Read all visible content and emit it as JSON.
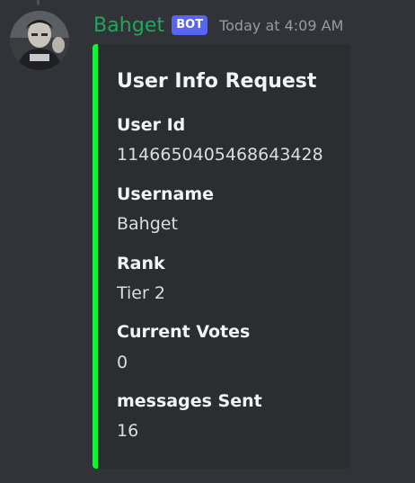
{
  "message": {
    "author": "Bahget",
    "bot_tag": "BOT",
    "timestamp": "Today at 4:09 AM",
    "avatar_icon": "user-avatar",
    "colors": {
      "author": "#23a55a",
      "bot_tag_bg": "#5865f2",
      "embed_accent": "#00ff2a",
      "background": "#313338",
      "embed_bg": "#2b2d31"
    }
  },
  "embed": {
    "title": "User Info Request",
    "fields": [
      {
        "name": "User Id",
        "value": "1146650405468643428"
      },
      {
        "name": "Username",
        "value": "Bahget"
      },
      {
        "name": "Rank",
        "value": "Tier 2"
      },
      {
        "name": "Current Votes",
        "value": "0"
      },
      {
        "name": "messages Sent",
        "value": "16"
      }
    ]
  }
}
